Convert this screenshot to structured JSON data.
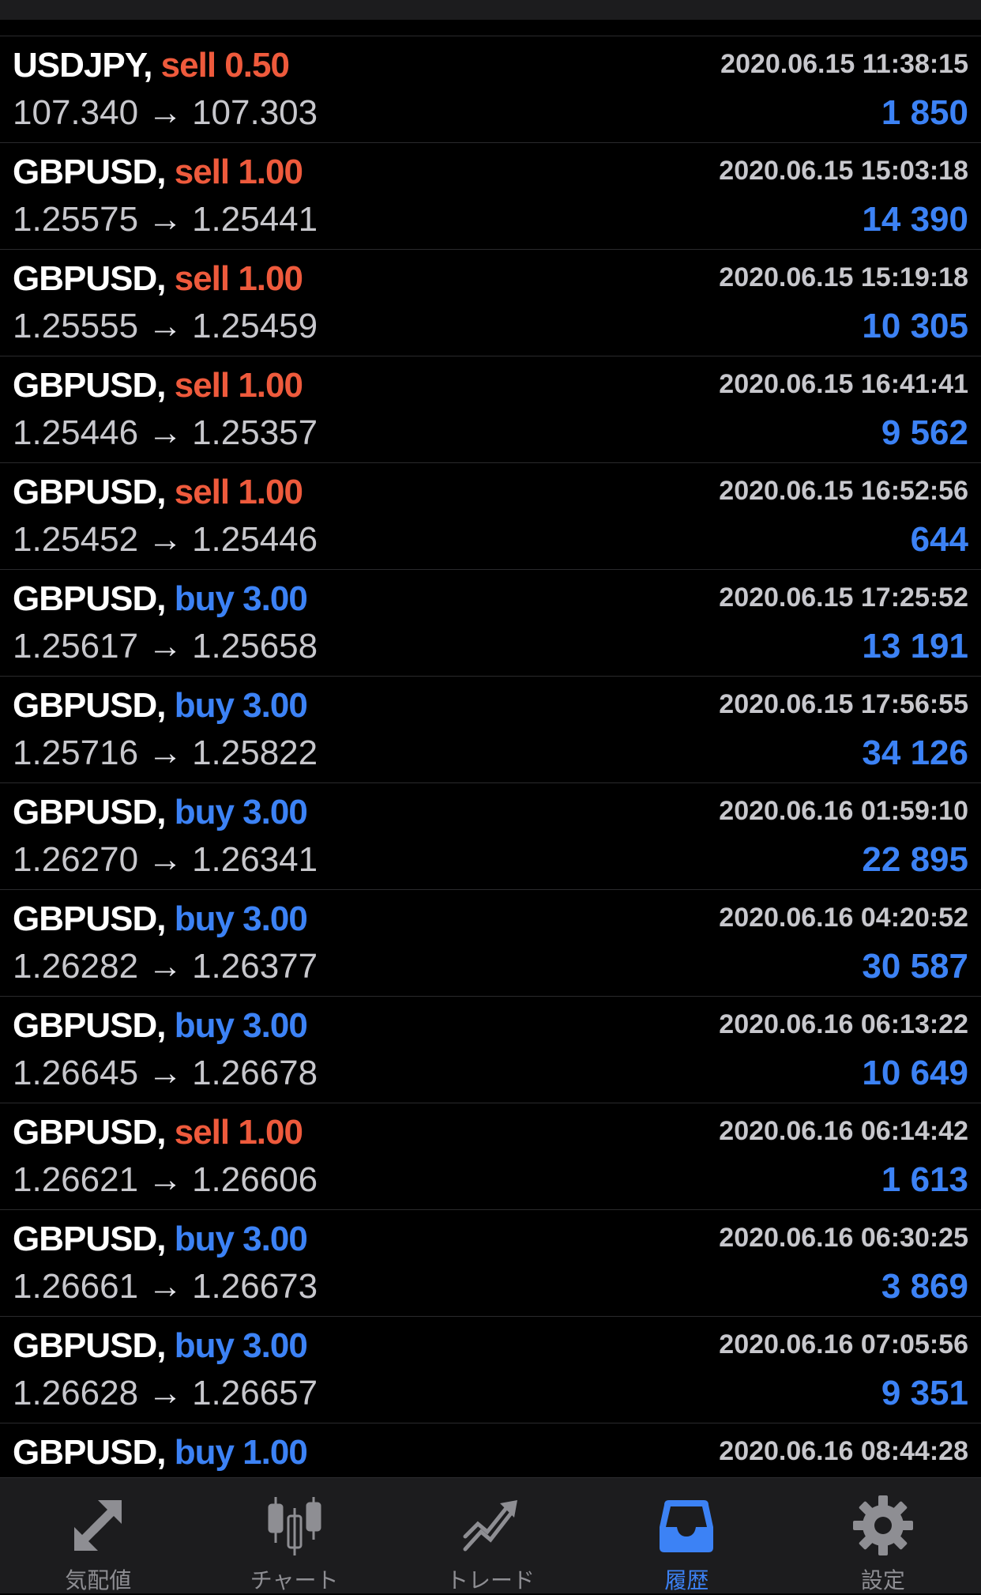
{
  "trades": [
    {
      "symbol": "USDJPY,",
      "side": "sell",
      "volume": "0.50",
      "time": "2020.06.15 11:38:15",
      "open_price": "107.340",
      "close_price": "107.303",
      "profit": "1 850"
    },
    {
      "symbol": "GBPUSD,",
      "side": "sell",
      "volume": "1.00",
      "time": "2020.06.15 15:03:18",
      "open_price": "1.25575",
      "close_price": "1.25441",
      "profit": "14 390"
    },
    {
      "symbol": "GBPUSD,",
      "side": "sell",
      "volume": "1.00",
      "time": "2020.06.15 15:19:18",
      "open_price": "1.25555",
      "close_price": "1.25459",
      "profit": "10 305"
    },
    {
      "symbol": "GBPUSD,",
      "side": "sell",
      "volume": "1.00",
      "time": "2020.06.15 16:41:41",
      "open_price": "1.25446",
      "close_price": "1.25357",
      "profit": "9 562"
    },
    {
      "symbol": "GBPUSD,",
      "side": "sell",
      "volume": "1.00",
      "time": "2020.06.15 16:52:56",
      "open_price": "1.25452",
      "close_price": "1.25446",
      "profit": "644"
    },
    {
      "symbol": "GBPUSD,",
      "side": "buy",
      "volume": "3.00",
      "time": "2020.06.15 17:25:52",
      "open_price": "1.25617",
      "close_price": "1.25658",
      "profit": "13 191"
    },
    {
      "symbol": "GBPUSD,",
      "side": "buy",
      "volume": "3.00",
      "time": "2020.06.15 17:56:55",
      "open_price": "1.25716",
      "close_price": "1.25822",
      "profit": "34 126"
    },
    {
      "symbol": "GBPUSD,",
      "side": "buy",
      "volume": "3.00",
      "time": "2020.06.16 01:59:10",
      "open_price": "1.26270",
      "close_price": "1.26341",
      "profit": "22 895"
    },
    {
      "symbol": "GBPUSD,",
      "side": "buy",
      "volume": "3.00",
      "time": "2020.06.16 04:20:52",
      "open_price": "1.26282",
      "close_price": "1.26377",
      "profit": "30 587"
    },
    {
      "symbol": "GBPUSD,",
      "side": "buy",
      "volume": "3.00",
      "time": "2020.06.16 06:13:22",
      "open_price": "1.26645",
      "close_price": "1.26678",
      "profit": "10 649"
    },
    {
      "symbol": "GBPUSD,",
      "side": "sell",
      "volume": "1.00",
      "time": "2020.06.16 06:14:42",
      "open_price": "1.26621",
      "close_price": "1.26606",
      "profit": "1 613"
    },
    {
      "symbol": "GBPUSD,",
      "side": "buy",
      "volume": "3.00",
      "time": "2020.06.16 06:30:25",
      "open_price": "1.26661",
      "close_price": "1.26673",
      "profit": "3 869"
    },
    {
      "symbol": "GBPUSD,",
      "side": "buy",
      "volume": "3.00",
      "time": "2020.06.16 07:05:56",
      "open_price": "1.26628",
      "close_price": "1.26657",
      "profit": "9 351"
    },
    {
      "symbol": "GBPUSD,",
      "side": "buy",
      "volume": "1.00",
      "time": "2020.06.16 08:44:28",
      "open_price": "",
      "close_price": "",
      "profit": ""
    }
  ],
  "arrow_glyph": "→",
  "tabbar": {
    "active": 3,
    "items": [
      {
        "label": "気配値",
        "icon": "quotes-arrows-icon"
      },
      {
        "label": "チャート",
        "icon": "candlestick-chart-icon"
      },
      {
        "label": "トレード",
        "icon": "trade-trend-icon"
      },
      {
        "label": "履歴",
        "icon": "history-inbox-icon"
      },
      {
        "label": "設定",
        "icon": "settings-gear-icon"
      }
    ]
  },
  "colors": {
    "background": "#000000",
    "sell": "#ee5a3c",
    "buy": "#3c82f5",
    "profit": "#3c82f5",
    "secondary_text": "#c7c7cc",
    "tab_inactive": "#8e8e93",
    "tab_active": "#3c82f5",
    "tabbar_bg": "#1c1c1e"
  }
}
